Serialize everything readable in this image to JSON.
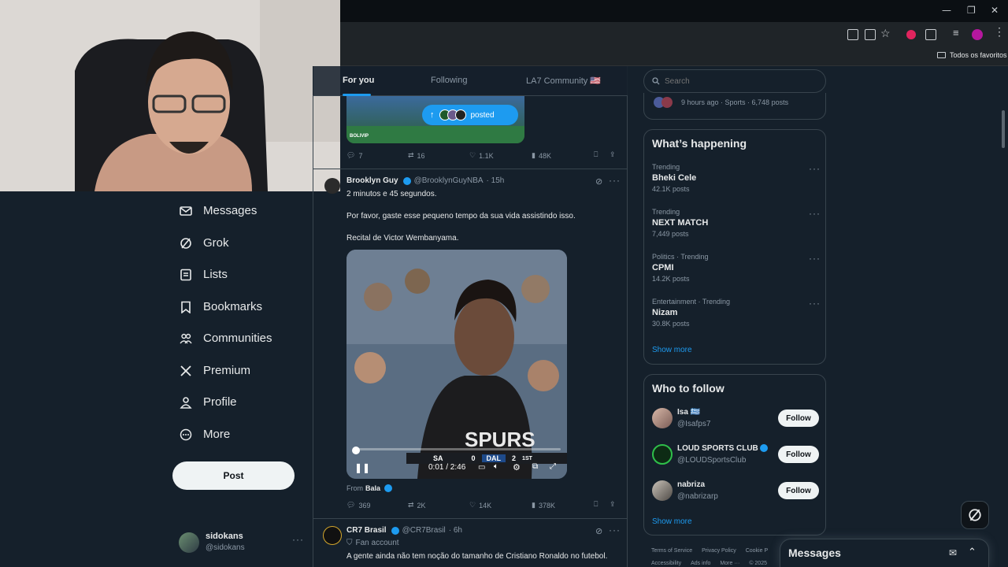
{
  "browser": {
    "bookmark_folder": "Todos os favoritos"
  },
  "nav": {
    "items": [
      {
        "label": "Messages",
        "icon": "envelope-icon"
      },
      {
        "label": "Grok",
        "icon": "grok-icon"
      },
      {
        "label": "Lists",
        "icon": "list-icon"
      },
      {
        "label": "Bookmarks",
        "icon": "bookmark-icon"
      },
      {
        "label": "Communities",
        "icon": "people-icon"
      },
      {
        "label": "Premium",
        "icon": "x-logo-icon"
      },
      {
        "label": "Profile",
        "icon": "person-icon"
      },
      {
        "label": "More",
        "icon": "more-circle-icon"
      }
    ],
    "post_button": "Post",
    "account": {
      "name": "sidokans",
      "handle": "@sidokans"
    }
  },
  "feed": {
    "tabs": [
      "For you",
      "Following",
      "LA7 Community 🇺🇸"
    ],
    "new_posts_pill": "posted",
    "prev_post": {
      "replies": "7",
      "reposts": "16",
      "likes": "1.1K",
      "views": "48K",
      "image_caption": "BOLIVIP"
    },
    "post1": {
      "name": "Brooklyn Guy",
      "handle": "@BrooklynGuyNBA",
      "time": "· 15h",
      "lines": [
        "2 minutos e 45 segundos.",
        "Por favor, gaste esse pequeno tempo da sua vida assistindo isso.",
        "Recital de Victor Wembanyama."
      ],
      "video": {
        "time": "0:01 / 2:46",
        "progress": 0.006,
        "score": {
          "team1": "SA",
          "score1": "0",
          "team2": "DAL",
          "score2": "2",
          "period": "1ST"
        }
      },
      "from_prefix": "From",
      "from_name": "Bala",
      "replies": "369",
      "reposts": "2K",
      "likes": "14K",
      "views": "378K"
    },
    "post2": {
      "name": "CR7 Brasil",
      "handle": "@CR7Brasil",
      "time": "· 6h",
      "label": "Fan account",
      "text": "A gente ainda não tem noção do tamanho de Cristiano Ronaldo no futebol."
    }
  },
  "right": {
    "search_placeholder": "Search",
    "top_trend_meta": "9 hours ago · Sports · 6,748 posts",
    "whats_happening": {
      "title": "What’s happening",
      "trends": [
        {
          "category": "Trending",
          "name": "Bheki Cele",
          "posts": "42.1K posts"
        },
        {
          "category": "Trending",
          "name": "NEXT MATCH",
          "posts": "7,449 posts"
        },
        {
          "category": "Politics · Trending",
          "name": "CPMI",
          "posts": "14.2K posts"
        },
        {
          "category": "Entertainment · Trending",
          "name": "Nizam",
          "posts": "30.8K posts"
        }
      ],
      "show_more": "Show more"
    },
    "who_to_follow": {
      "title": "Who to follow",
      "accounts": [
        {
          "name": "Isa 🇬🇷",
          "handle": "@Isafps7",
          "verified": false
        },
        {
          "name": "LOUD SPORTS CLUB",
          "handle": "@LOUDSportsClub",
          "verified": true
        },
        {
          "name": "nabriza",
          "handle": "@nabrizarp",
          "verified": false
        }
      ],
      "follow_label": "Follow",
      "show_more": "Show more"
    },
    "footer": {
      "row1": [
        "Terms of Service",
        "Privacy Policy",
        "Cookie P"
      ],
      "row2": [
        "Accessibility",
        "Ads info",
        "More ···",
        "© 2025"
      ]
    },
    "messages_drawer": "Messages"
  },
  "colors": {
    "accent": "#1d9bf0",
    "bg": "#15202b",
    "border": "#38444d"
  }
}
